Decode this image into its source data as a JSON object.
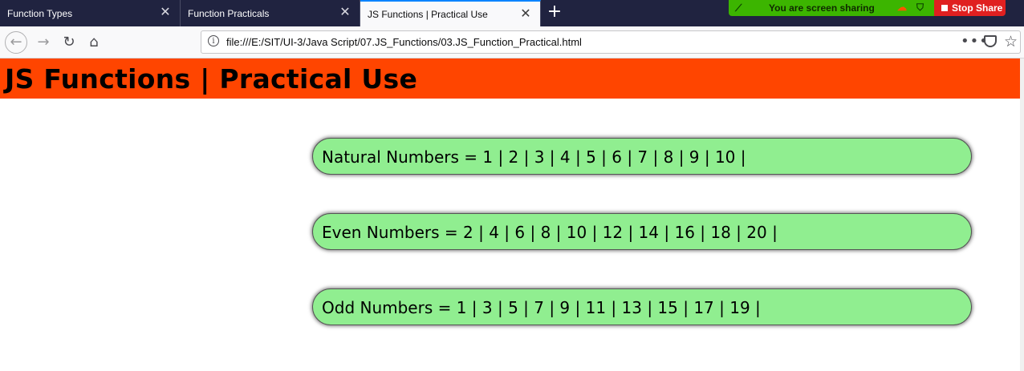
{
  "tabs": [
    {
      "label": "Function Types",
      "active": false
    },
    {
      "label": "Function Practicals",
      "active": false
    },
    {
      "label": "JS Functions | Practical Use",
      "active": true
    }
  ],
  "screen_sharing": {
    "message": "You are screen sharing",
    "stop_label": "Stop Share",
    "bar_color": "#3cb500",
    "stop_color": "#e02020"
  },
  "toolbar": {
    "url": "file:///E:/SIT/UI-3/Java Script/07.JS_Functions/03.JS_Function_Practical.html",
    "icons": [
      "back-icon",
      "forward-icon",
      "reload-icon",
      "home-icon",
      "info-icon",
      "page-actions-icon",
      "pocket-icon",
      "bookmark-star-icon"
    ]
  },
  "page": {
    "title": "JS Functions | Practical Use",
    "header_color": "#ff4500",
    "box_color": "#90ee90",
    "rows": {
      "natural": "Natural Numbers = 1 | 2 | 3 | 4 | 5 | 6 | 7 | 8 | 9 | 10 |",
      "even": "Even Numbers = 2 | 4 | 6 | 8 | 10 | 12 | 14 | 16 | 18 | 20 |",
      "odd": "Odd Numbers = 1 | 3 | 5 | 7 | 9 | 11 | 13 | 15 | 17 | 19 |"
    }
  }
}
